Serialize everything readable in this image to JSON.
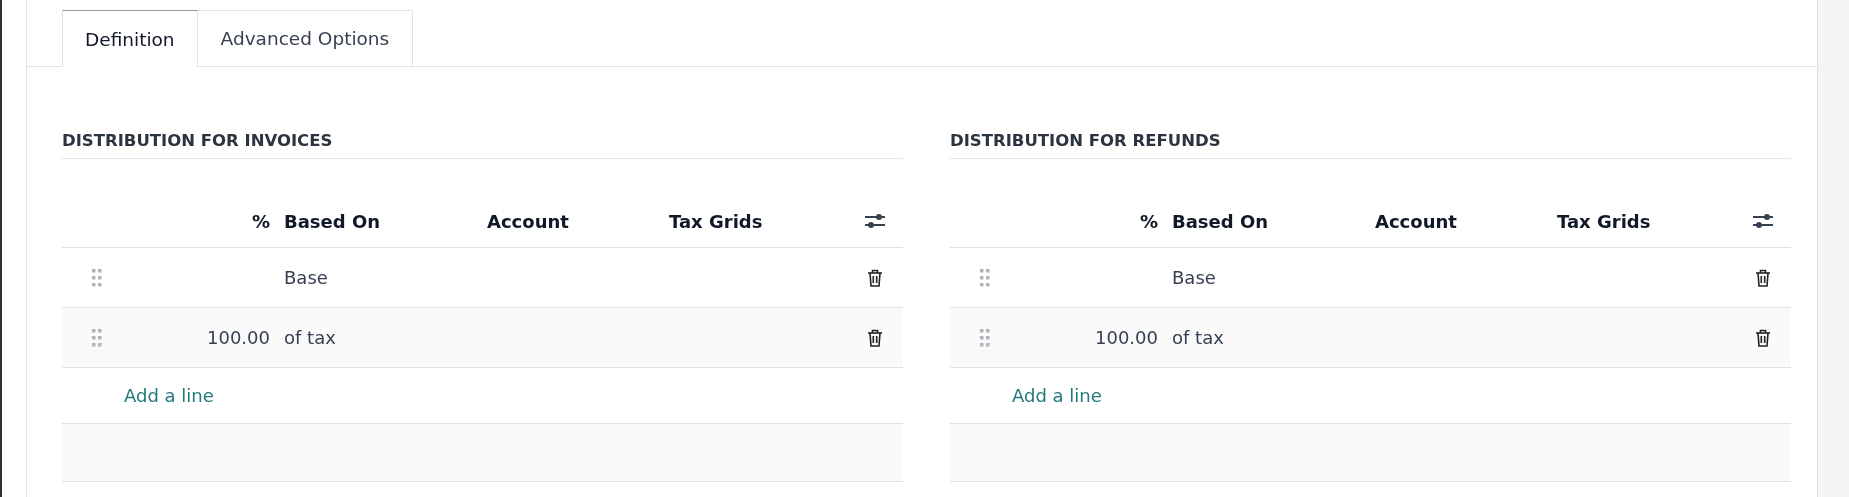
{
  "tabs": [
    {
      "label": "Definition",
      "selected": true
    },
    {
      "label": "Advanced Options",
      "selected": false
    }
  ],
  "sections": [
    {
      "title": "DISTRIBUTION FOR INVOICES",
      "columns": [
        "%",
        "Based On",
        "Account",
        "Tax Grids"
      ],
      "rows": [
        {
          "percent": "",
          "based_on": "Base"
        },
        {
          "percent": "100.00",
          "based_on": "of tax"
        }
      ],
      "add_line": "Add a line"
    },
    {
      "title": "DISTRIBUTION FOR REFUNDS",
      "columns": [
        "%",
        "Based On",
        "Account",
        "Tax Grids"
      ],
      "rows": [
        {
          "percent": "",
          "based_on": "Base"
        },
        {
          "percent": "100.00",
          "based_on": "of tax"
        }
      ],
      "add_line": "Add a line"
    }
  ]
}
